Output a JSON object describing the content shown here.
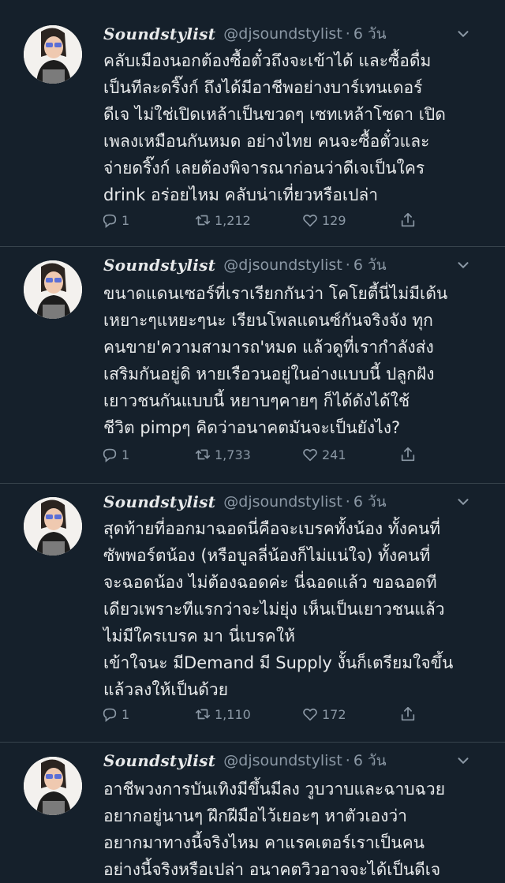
{
  "author": {
    "display_name": "Soundstylist",
    "handle": "@djsoundstylist",
    "separator": "·",
    "time": "6 วัน"
  },
  "tweets": [
    {
      "lines": [
        "คลับเมืองนอกต้องซื้อตั๋วถึงจะเข้าได้ และซื้อดื่ม",
        "เป็นทีละดริ๊งก์ ถึงได้มีอาชีพอย่างบาร์เทนเดอร์",
        "ดีเจ ไม่ใช่เปิดเหล้าเป็นขวดๆ เซทเหล้าโซดา เปิด",
        "เพลงเหมือนกันหมด อย่างไทย คนจะซื้อตั๋วและ",
        "จ่ายดริ๊งก์ เลยต้องพิจารณาก่อนว่าดีเจเป็นใคร",
        "drink อร่อยไหม คลับน่าเที่ยวหรือเปล่า"
      ],
      "replies": "1",
      "retweets": "1,212",
      "likes": "129"
    },
    {
      "lines": [
        "ขนาดแดนเซอร์ที่เราเรียกกันว่า โคโยตี้นี่ไม่มีเต้น",
        "เหยาะๆแหยะๆนะ เรียนโพลแดนซ์กันจริงจัง ทุก",
        "คนขาย'ความสามารถ'หมด แล้วดูที่เรากำลังส่ง",
        "เสริมกันอยู่ดิ หายเรือวนอยู่ในอ่างแบบนี้ ปลูกฝัง",
        "เยาวชนกันแบบนี้ หยาบๆคายๆ ก็ได้ดังได้ใช้",
        "ชีวิต pimpๆ คิดว่าอนาคตมันจะเป็นยังไง?"
      ],
      "replies": "1",
      "retweets": "1,733",
      "likes": "241"
    },
    {
      "lines": [
        "สุดท้ายที่ออกมาฉอดนี่คือจะเบรคทั้งน้อง ทั้งคนที่",
        "ซัพพอร์ตน้อง (หรือบูลลี่น้องก็ไม่แน่ใจ) ทั้งคนที่",
        "จะฉอดน้อง ไม่ต้องฉอดค่ะ นี่ฉอดแล้ว ขอฉอดที",
        "เดียวเพราะทีแรกว่าจะไม่ยุ่ง เห็นเป็นเยาวชนแล้ว",
        "ไม่มีใครเบรค มา นี่เบรคให้",
        "เข้าใจนะ มีDemand มี Supply งั้นก็เตรียมใจขึ้น",
        "แล้วลงให้เป็นด้วย"
      ],
      "replies": "1",
      "retweets": "1,110",
      "likes": "172"
    },
    {
      "lines": [
        "อาชีพวงการบันเทิงมีขึ้นมีลง วูบวาบและฉาบฉวย",
        "อยากอยู่นานๆ ฝึกฝีมือไว้เยอะๆ หาตัวเองว่า",
        "อยากมาทางนี้จริงไหม คาแรคเตอร์เราเป็นคน",
        "อย่างนี้จริงหรือเปล่า อนาคตวิวอาจจะได้เป็นดีเจ"
      ]
    }
  ]
}
